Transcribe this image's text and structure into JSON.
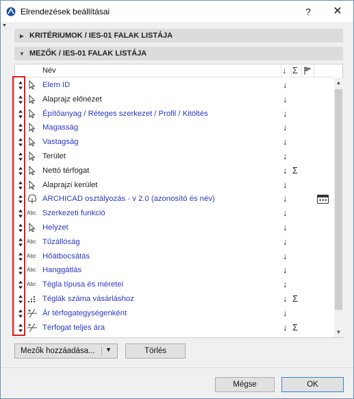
{
  "window": {
    "title": "Elrendezések beállításai",
    "help_glyph": "?",
    "close_glyph": "✕"
  },
  "panels": {
    "criteria_title": "KRITÉRIUMOK / IES-01 FALAK LISTÁJA",
    "fields_title": "MEZŐK / IES-01 FALAK LISTÁJA"
  },
  "list_header": {
    "name": "Név",
    "sort_glyph": "↓",
    "sum_glyph": "Σ"
  },
  "rows": [
    {
      "label": "Elem ID",
      "type": "cursor",
      "color": "blue",
      "sum": false,
      "more": false
    },
    {
      "label": "Alaprajz előnézet",
      "type": "cursor",
      "color": "dark",
      "sum": false,
      "more": false
    },
    {
      "label": "Építőanyag / Réteges szerkezet / Profil / Kitöltés",
      "type": "cursor",
      "color": "blue",
      "sum": false,
      "more": false
    },
    {
      "label": "Magasság",
      "type": "cursor",
      "color": "blue",
      "sum": false,
      "more": false
    },
    {
      "label": "Vastagság",
      "type": "cursor",
      "color": "blue",
      "sum": false,
      "more": false
    },
    {
      "label": "Terület",
      "type": "cursor",
      "color": "dark",
      "sum": false,
      "more": false
    },
    {
      "label": "Nettó térfogat",
      "type": "cursor",
      "color": "dark",
      "sum": true,
      "more": false
    },
    {
      "label": "Alaprajzi kerület",
      "type": "cursor",
      "color": "dark",
      "sum": false,
      "more": false
    },
    {
      "label": "ARCHICAD osztályozás - v 2.0 (azonosító és név)",
      "type": "tree",
      "color": "blue",
      "sum": false,
      "more": true
    },
    {
      "label": "Szerkezeti funkció",
      "type": "abc",
      "color": "blue",
      "sum": false,
      "more": false
    },
    {
      "label": "Helyzet",
      "type": "cursor",
      "color": "blue",
      "sum": false,
      "more": false
    },
    {
      "label": "Tűzállóság",
      "type": "abc",
      "color": "blue",
      "sum": false,
      "more": false
    },
    {
      "label": "Hőátbocsátás",
      "type": "abc",
      "color": "blue",
      "sum": false,
      "more": false
    },
    {
      "label": "Hanggátlás",
      "type": "abc",
      "color": "blue",
      "sum": false,
      "more": false
    },
    {
      "label": "Tégla típusa és méretei",
      "type": "abc",
      "color": "blue",
      "sum": false,
      "more": false
    },
    {
      "label": "Téglák száma vásárláshoz",
      "type": "num",
      "color": "blue",
      "sum": true,
      "more": false
    },
    {
      "label": "Ár térfogategységenként",
      "type": "calc",
      "color": "blue",
      "sum": false,
      "more": false
    },
    {
      "label": "Térfogat teljes ára",
      "type": "calc",
      "color": "blue",
      "sum": true,
      "more": false
    }
  ],
  "type_text": {
    "abc": "Abc"
  },
  "buttons": {
    "add_fields": "Mezők hozzáadása...",
    "delete": "Törlés",
    "cancel": "Mégse",
    "ok": "OK"
  },
  "colors": {
    "link_blue": "#2b36c4",
    "highlight_red": "#e01818",
    "ok_border": "#3c7fd4"
  }
}
